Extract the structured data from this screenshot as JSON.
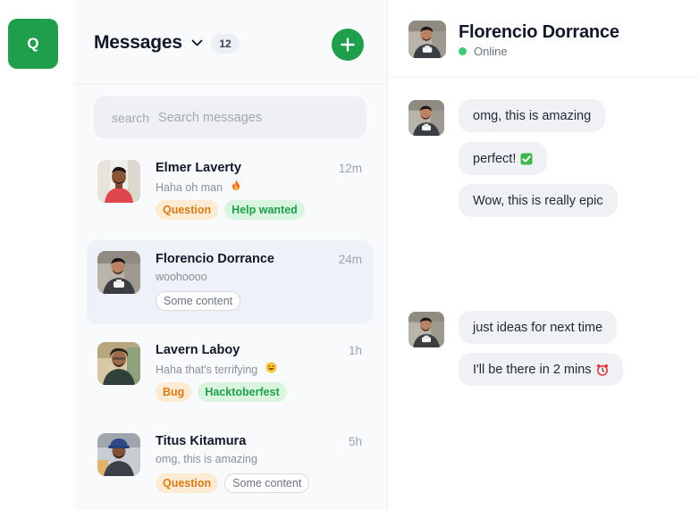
{
  "rail": {
    "app_badge": "Q"
  },
  "messages_panel": {
    "title": "Messages",
    "count": "12",
    "search": {
      "label": "search",
      "placeholder": "Search messages"
    },
    "conversations": [
      {
        "name": "Elmer Laverty",
        "time": "12m",
        "preview": "Haha oh man",
        "preview_icon": "fire-emoji-icon",
        "tags": [
          "Question",
          "Help wanted"
        ],
        "active": false
      },
      {
        "name": "Florencio Dorrance",
        "time": "24m",
        "preview": "woohoooo",
        "tags": [
          "Some content"
        ],
        "active": true
      },
      {
        "name": "Lavern Laboy",
        "time": "1h",
        "preview": "Haha that's terrifying",
        "preview_icon": "grinning-sweat-emoji-icon",
        "tags": [
          "Bug",
          "Hacktoberfest"
        ],
        "active": false
      },
      {
        "name": "Titus Kitamura",
        "time": "5h",
        "preview": "omg, this is amazing",
        "tags": [
          "Question",
          "Some content"
        ],
        "active": false
      }
    ]
  },
  "chat": {
    "contact_name": "Florencio Dorrance",
    "status": "Online",
    "messages": [
      {
        "text": "omg, this is amazing"
      },
      {
        "text": "perfect!",
        "icon": "check-mark-emoji-icon"
      },
      {
        "text": "Wow, this is really epic"
      },
      {
        "text": "just ideas for next time"
      },
      {
        "text": "I'll be there in 2 mins",
        "icon": "alarm-clock-emoji-icon"
      }
    ]
  },
  "colors": {
    "brand_green": "#1f9e4b",
    "tag_orange_bg": "#fdebd3",
    "tag_orange_text": "#d97a16",
    "tag_green_bg": "#d9f5df",
    "tag_green_text": "#1f9e4b",
    "online": "#3ccc75",
    "active_row": "#eef1f8"
  }
}
